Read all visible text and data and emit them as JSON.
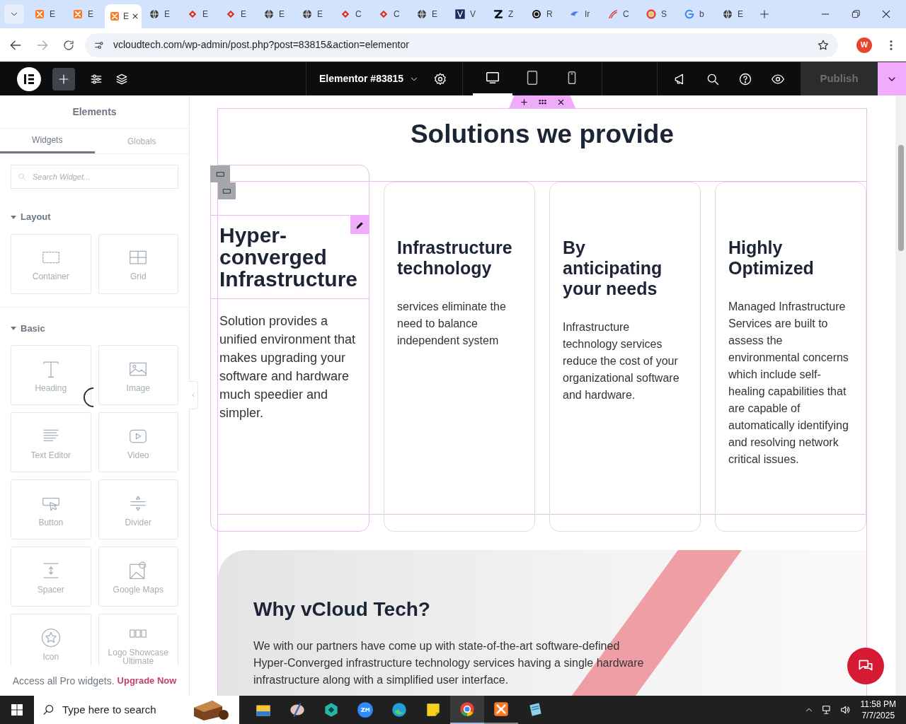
{
  "browser": {
    "tabs": [
      {
        "label": "E",
        "selected": false
      },
      {
        "label": "E",
        "selected": false
      },
      {
        "label": "E",
        "selected": true
      },
      {
        "label": "E",
        "selected": false
      },
      {
        "label": "E",
        "selected": false
      },
      {
        "label": "E",
        "selected": false
      },
      {
        "label": "E",
        "selected": false
      },
      {
        "label": "E",
        "selected": false
      },
      {
        "label": "C",
        "selected": false
      },
      {
        "label": "C",
        "selected": false
      },
      {
        "label": "E",
        "selected": false
      },
      {
        "label": "V",
        "selected": false
      },
      {
        "label": "Z",
        "selected": false
      },
      {
        "label": "R",
        "selected": false
      },
      {
        "label": "Ir",
        "selected": false
      },
      {
        "label": "C",
        "selected": false
      },
      {
        "label": "S",
        "selected": false
      },
      {
        "label": "b",
        "selected": false
      },
      {
        "label": "E",
        "selected": false
      }
    ],
    "url": "vcloudtech.com/wp-admin/post.php?post=83815&action=elementor",
    "profile": "W"
  },
  "editor": {
    "document_title": "Elementor #83815",
    "devices": [
      {
        "kind": "desktop",
        "selected": true
      },
      {
        "kind": "tablet",
        "selected": false
      },
      {
        "kind": "mobile",
        "selected": false
      }
    ],
    "publish": {
      "label": "Publish",
      "disabled": true
    }
  },
  "panel": {
    "title": "Elements",
    "tabs": [
      {
        "label": "Widgets",
        "selected": true
      },
      {
        "label": "Globals",
        "selected": false
      }
    ],
    "search": {
      "placeholder": "Search Widget..."
    },
    "sections": [
      {
        "title": "Layout",
        "expanded": true,
        "widgets": [
          {
            "label": "Container",
            "kind": "container"
          },
          {
            "label": "Grid",
            "kind": "grid"
          }
        ]
      },
      {
        "title": "Basic",
        "expanded": true,
        "widgets": [
          {
            "label": "Heading",
            "kind": "heading"
          },
          {
            "label": "Image",
            "kind": "image"
          },
          {
            "label": "Text Editor",
            "kind": "text"
          },
          {
            "label": "Video",
            "kind": "video"
          },
          {
            "label": "Button",
            "kind": "button"
          },
          {
            "label": "Divider",
            "kind": "divider"
          },
          {
            "label": "Spacer",
            "kind": "spacer"
          },
          {
            "label": "Google Maps",
            "kind": "maps"
          },
          {
            "label": "Icon",
            "kind": "star"
          },
          {
            "label": "Logo Showcase Ultimate",
            "kind": "logos"
          }
        ]
      }
    ],
    "footer": {
      "text": "Access all Pro widgets.",
      "link": "Upgrade Now"
    }
  },
  "canvas": {
    "heading": "Solutions we provide",
    "cards": [
      {
        "title": "Hyper-converged Infrastructure",
        "body": "Solution provides a unified environment that makes upgrading your software and hardware much speedier and simpler.",
        "selected": true
      },
      {
        "title": "Infrastructure technology",
        "body": "services eliminate the need to balance independent system",
        "selected": false
      },
      {
        "title": "By anticipating your needs",
        "body": "Infrastructure technology services reduce the cost of your organizational software and hardware.",
        "selected": false
      },
      {
        "title": "Highly Optimized",
        "body": "Managed Infrastructure Services are built to assess the environmental concerns which include self-healing capabilities that are capable of automatically identifying and resolving network critical issues.",
        "selected": false
      }
    ],
    "why": {
      "heading": "Why vCloud Tech?",
      "body": "We with our partners have come up with state-of-the-art software-defined Hyper-Converged infrastructure technology services having a single hardware infrastructure along with a simplified user interface."
    }
  },
  "taskbar": {
    "search_placeholder": "Type here to search",
    "time": "11:58 PM",
    "date": "7/7/2025"
  }
}
